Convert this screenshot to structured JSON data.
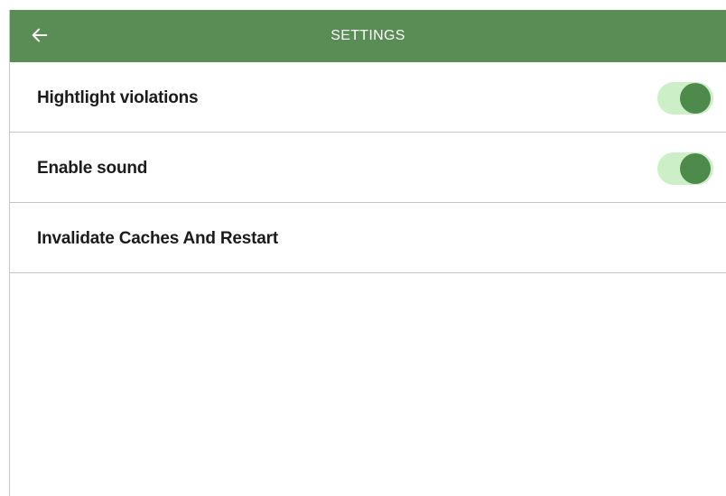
{
  "app_bar": {
    "title": "SETTINGS",
    "back_icon": "arrow-left-icon",
    "background_color": "#5a8d55",
    "text_color": "#ffffff"
  },
  "settings": {
    "items": [
      {
        "label": "Hightlight violations",
        "toggle": true,
        "enabled": true
      },
      {
        "label": "Enable sound",
        "toggle": true,
        "enabled": true
      },
      {
        "label": "Invalidate Caches And Restart",
        "toggle": false
      }
    ]
  },
  "colors": {
    "toggle_track_on": "#cdefc7",
    "toggle_thumb_on": "#4f8a4d",
    "divider": "#c4c4c4"
  }
}
